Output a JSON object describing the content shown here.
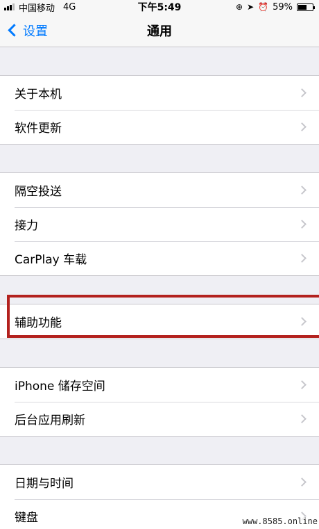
{
  "status_bar": {
    "carrier": "中国移动",
    "network": "4G",
    "time": "下午5:49",
    "battery": "59%",
    "battery_level": 0.59
  },
  "nav": {
    "back_label": "设置",
    "title": "通用"
  },
  "groups": [
    [
      "关于本机",
      "软件更新"
    ],
    [
      "隔空投送",
      "接力",
      "CarPlay 车载"
    ],
    [
      "辅助功能"
    ],
    [
      "iPhone 储存空间",
      "后台应用刷新"
    ],
    [
      "日期与时间",
      "键盘"
    ]
  ],
  "highlighted_item": "辅助功能",
  "colors": {
    "accent": "#007aff",
    "highlight_border": "#b3211e",
    "background": "#efeff4"
  },
  "watermark": "www.8585.online"
}
